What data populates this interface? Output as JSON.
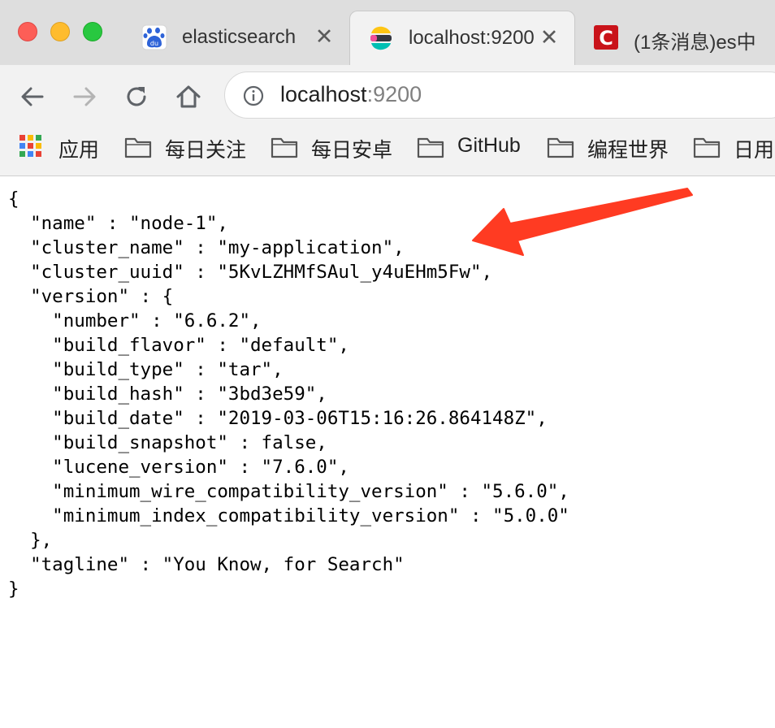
{
  "window": {
    "controls": [
      "close-icon",
      "minimize-icon",
      "maximize-icon"
    ],
    "colors": {
      "close": "#fd5e57",
      "minimize": "#febc2e",
      "maximize": "#28c840"
    }
  },
  "tabs": [
    {
      "title": "elasticsearch",
      "favicon": "baidu-paw-icon",
      "active": false
    },
    {
      "title": "localhost:9200",
      "favicon": "elastic-logo-icon",
      "active": true
    },
    {
      "title": "(1条消息)es中",
      "favicon": "csdn-c-icon",
      "active": false
    }
  ],
  "toolbar": {
    "back_icon": "arrow-left-icon",
    "forward_icon": "arrow-right-icon",
    "reload_icon": "reload-icon",
    "home_icon": "home-icon",
    "url_host": "localhost",
    "url_port": ":9200"
  },
  "bookmarks": [
    {
      "label": "应用",
      "icon": "apps-grid-icon"
    },
    {
      "label": "每日关注",
      "icon": "folder-icon"
    },
    {
      "label": "每日安卓",
      "icon": "folder-icon"
    },
    {
      "label": "GitHub",
      "icon": "folder-icon"
    },
    {
      "label": "编程世界",
      "icon": "folder-icon"
    },
    {
      "label": "日用",
      "icon": "folder-icon"
    }
  ],
  "json_lines": [
    "{",
    "  \"name\" : \"node-1\",",
    "  \"cluster_name\" : \"my-application\",",
    "  \"cluster_uuid\" : \"5KvLZHMfSAul_y4uEHm5Fw\",",
    "  \"version\" : {",
    "    \"number\" : \"6.6.2\",",
    "    \"build_flavor\" : \"default\",",
    "    \"build_type\" : \"tar\",",
    "    \"build_hash\" : \"3bd3e59\",",
    "    \"build_date\" : \"2019-03-06T15:16:26.864148Z\",",
    "    \"build_snapshot\" : false,",
    "    \"lucene_version\" : \"7.6.0\",",
    "    \"minimum_wire_compatibility_version\" : \"5.6.0\",",
    "    \"minimum_index_compatibility_version\" : \"5.0.0\"",
    "  },",
    "  \"tagline\" : \"You Know, for Search\"",
    "}"
  ],
  "annotation": {
    "icon": "red-arrow-icon",
    "color": "#ff3b22"
  }
}
